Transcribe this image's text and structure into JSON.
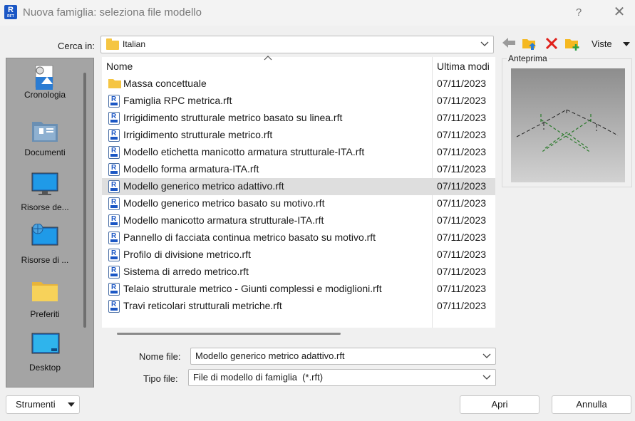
{
  "window": {
    "title": "Nuova famiglia: seleziona file modello",
    "app_icon_text": "R",
    "app_icon_sub": "RFT",
    "help": "?",
    "close": "✕"
  },
  "look_in": {
    "label": "Cerca in:",
    "value": "Italian"
  },
  "toolbar": {
    "back_icon": "back-arrow-icon",
    "up_icon": "folder-up-icon",
    "delete_icon": "delete-x-icon",
    "new_folder_icon": "new-folder-icon",
    "views_label": "Viste"
  },
  "places": [
    {
      "label": "Cronologia",
      "icon": "history-icon"
    },
    {
      "label": "Documenti",
      "icon": "documents-icon"
    },
    {
      "label": "Risorse de...",
      "icon": "monitor-icon"
    },
    {
      "label": "Risorse di ...",
      "icon": "network-globe-icon"
    },
    {
      "label": "Preferiti",
      "icon": "favorites-folder-icon"
    },
    {
      "label": "Desktop",
      "icon": "desktop-icon"
    }
  ],
  "file_list": {
    "col_name": "Nome",
    "col_date": "Ultima modi",
    "rows": [
      {
        "name": "Massa concettuale",
        "date": "07/11/2023",
        "type": "folder"
      },
      {
        "name": "Famiglia RPC metrica.rft",
        "date": "07/11/2023",
        "type": "rft"
      },
      {
        "name": "Irrigidimento strutturale metrico basato su linea.rft",
        "date": "07/11/2023",
        "type": "rft"
      },
      {
        "name": "Irrigidimento strutturale metrico.rft",
        "date": "07/11/2023",
        "type": "rft"
      },
      {
        "name": "Modello etichetta manicotto armatura strutturale-ITA.rft",
        "date": "07/11/2023",
        "type": "rft"
      },
      {
        "name": "Modello forma armatura-ITA.rft",
        "date": "07/11/2023",
        "type": "rft"
      },
      {
        "name": "Modello generico metrico adattivo.rft",
        "date": "07/11/2023",
        "type": "rft",
        "selected": true
      },
      {
        "name": "Modello generico metrico basato su motivo.rft",
        "date": "07/11/2023",
        "type": "rft"
      },
      {
        "name": "Modello manicotto armatura strutturale-ITA.rft",
        "date": "07/11/2023",
        "type": "rft"
      },
      {
        "name": "Pannello di facciata continua metrico basato su motivo.rft",
        "date": "07/11/2023",
        "type": "rft"
      },
      {
        "name": "Profilo di divisione metrico.rft",
        "date": "07/11/2023",
        "type": "rft"
      },
      {
        "name": "Sistema di arredo metrico.rft",
        "date": "07/11/2023",
        "type": "rft"
      },
      {
        "name": "Telaio strutturale metrico - Giunti complessi e modiglioni.rft",
        "date": "07/11/2023",
        "type": "rft"
      },
      {
        "name": "Travi reticolari strutturali metriche.rft",
        "date": "07/11/2023",
        "type": "rft"
      }
    ]
  },
  "preview": {
    "label": "Anteprima"
  },
  "file_name": {
    "label": "Nome file:",
    "value": "Modello generico metrico adattivo.rft"
  },
  "file_type": {
    "label": "Tipo file:",
    "value": "File di modello di famiglia  (*.rft)"
  },
  "buttons": {
    "tools": "Strumenti",
    "open": "Apri",
    "cancel": "Annulla"
  }
}
